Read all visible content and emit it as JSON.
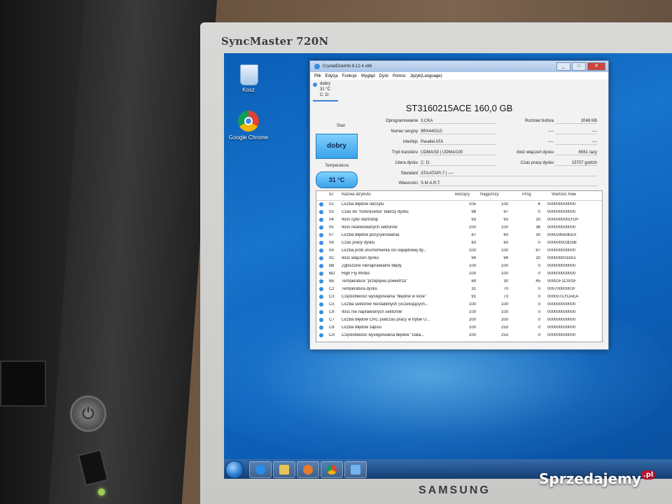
{
  "monitor": {
    "model_label": "SyncMaster 720N",
    "brand_label": "SAMSUNG"
  },
  "pc": {
    "power_symbol": "⏻"
  },
  "desktop": {
    "icons": [
      {
        "label": "Kosz",
        "icon": "recycle-bin-icon"
      },
      {
        "label": "Google Chrome",
        "icon": "chrome-icon"
      }
    ]
  },
  "app": {
    "title": "CrystalDiskInfo 8.12.4 x86",
    "menu": [
      "Plik",
      "Edycja",
      "Funkcje",
      "Wygląd",
      "Dysk",
      "Pomoc",
      "Język(Language)"
    ],
    "disk_tab": {
      "status": "dobry",
      "temp": "31 °C",
      "letters": "C: D:"
    },
    "disk_title": "ST3160215ACE 160,0 GB",
    "status_label": "Stan",
    "status_value": "dobry",
    "temp_label": "Temperatura",
    "temp_value": "31 °C",
    "info": {
      "firmware_label": "Oprogramowanie",
      "firmware": "3.CKA",
      "serial_label": "Numer seryjny",
      "serial": "9RX44G1G",
      "interface_label": "Interfejs",
      "interface": "Parallel ATA",
      "transfer_label": "Tryb transferu",
      "transfer": "UDMA/33 | UDMA/100",
      "letter_label": "Litera dysku",
      "letter": "C: D:",
      "standard_label": "Standard",
      "standard": "ATA/ATAPI-7 | ----",
      "features_label": "Własności",
      "features": "S.M.A.R.T.",
      "buffer_label": "Rozmiar bufora",
      "buffer": "2048 KB",
      "blank1_label": "----",
      "blank1": "----",
      "blank2_label": "----",
      "blank2": "----",
      "power_on_count_label": "Ilość włączeń dysku",
      "power_on_count": "6561 razy",
      "power_on_hours_label": "Czas pracy dysku",
      "power_on_hours": "15707 godzin"
    },
    "smart": {
      "headers": [
        "ID",
        "Nazwa atrybutu",
        "Bieżący",
        "Najgorszy",
        "Próg",
        "Wartość Raw"
      ],
      "rows": [
        {
          "id": "01",
          "name": "Liczba błędów odczytu",
          "cur": "105",
          "worst": "100",
          "thr": "6",
          "raw": "000000000000"
        },
        {
          "id": "03",
          "name": "Czas do \"rozkręcenia\" talerzy dysku",
          "cur": "98",
          "worst": "97",
          "thr": "0",
          "raw": "000000000000"
        },
        {
          "id": "04",
          "name": "Ilość cykli start/stop",
          "cur": "93",
          "worst": "93",
          "thr": "20",
          "raw": "0000000001FDF"
        },
        {
          "id": "05",
          "name": "Ilość realokowanych sektorów",
          "cur": "100",
          "worst": "100",
          "thr": "36",
          "raw": "000000000000"
        },
        {
          "id": "07",
          "name": "Liczba błędów pozycjonowania",
          "cur": "87",
          "worst": "60",
          "thr": "30",
          "raw": "000024583EE0"
        },
        {
          "id": "09",
          "name": "Czas pracy dysku",
          "cur": "83",
          "worst": "83",
          "thr": "0",
          "raw": "000000003D5B"
        },
        {
          "id": "0A",
          "name": "Liczba prób uruchomienia osi napędowej dy...",
          "cur": "100",
          "worst": "100",
          "thr": "97",
          "raw": "000000000000"
        },
        {
          "id": "0C",
          "name": "Ilość włączeń dysku",
          "cur": "94",
          "worst": "94",
          "thr": "20",
          "raw": "0000000019A1"
        },
        {
          "id": "B8",
          "name": "Zgłoszone nienaprawialne błędy",
          "cur": "100",
          "worst": "100",
          "thr": "0",
          "raw": "000000000000"
        },
        {
          "id": "BD",
          "name": "High Fly Writes",
          "cur": "100",
          "worst": "100",
          "thr": "0",
          "raw": "000000000000"
        },
        {
          "id": "BE",
          "name": "Temperatura \"przepływu powietrza\"",
          "cur": "69",
          "worst": "30",
          "thr": "45",
          "raw": "00001F1C001F"
        },
        {
          "id": "C2",
          "name": "Temperatura dysku",
          "cur": "31",
          "worst": "70",
          "thr": "0",
          "raw": "00070000001F"
        },
        {
          "id": "C3",
          "name": "Częstotliwość występowania \"błędów w locie\"",
          "cur": "91",
          "worst": "73",
          "thr": "0",
          "raw": "000007CFDAEA"
        },
        {
          "id": "C5",
          "name": "Liczba sektorów niestabilnych (oczekujących...",
          "cur": "100",
          "worst": "100",
          "thr": "0",
          "raw": "000000000000"
        },
        {
          "id": "C6",
          "name": "Ilość nie naprawionych sektorów",
          "cur": "100",
          "worst": "100",
          "thr": "0",
          "raw": "000000000000"
        },
        {
          "id": "C7",
          "name": "Liczba błędów CRC podczas pracy w trybie U...",
          "cur": "200",
          "worst": "200",
          "thr": "0",
          "raw": "000000000000"
        },
        {
          "id": "C8",
          "name": "Liczba błędów zapisu",
          "cur": "100",
          "worst": "253",
          "thr": "0",
          "raw": "000000000000"
        },
        {
          "id": "CA",
          "name": "Częstotliwość występowania błędów \"Data...",
          "cur": "100",
          "worst": "253",
          "thr": "0",
          "raw": "000000000000"
        }
      ]
    }
  },
  "taskbar": {
    "pinned": [
      "start-orb-icon",
      "internet-explorer-icon",
      "file-explorer-icon",
      "media-player-icon",
      "chrome-icon",
      "crystaldiskinfo-icon"
    ]
  },
  "watermark": {
    "text": "Sprzedajemy",
    "suffix": ".pl"
  }
}
